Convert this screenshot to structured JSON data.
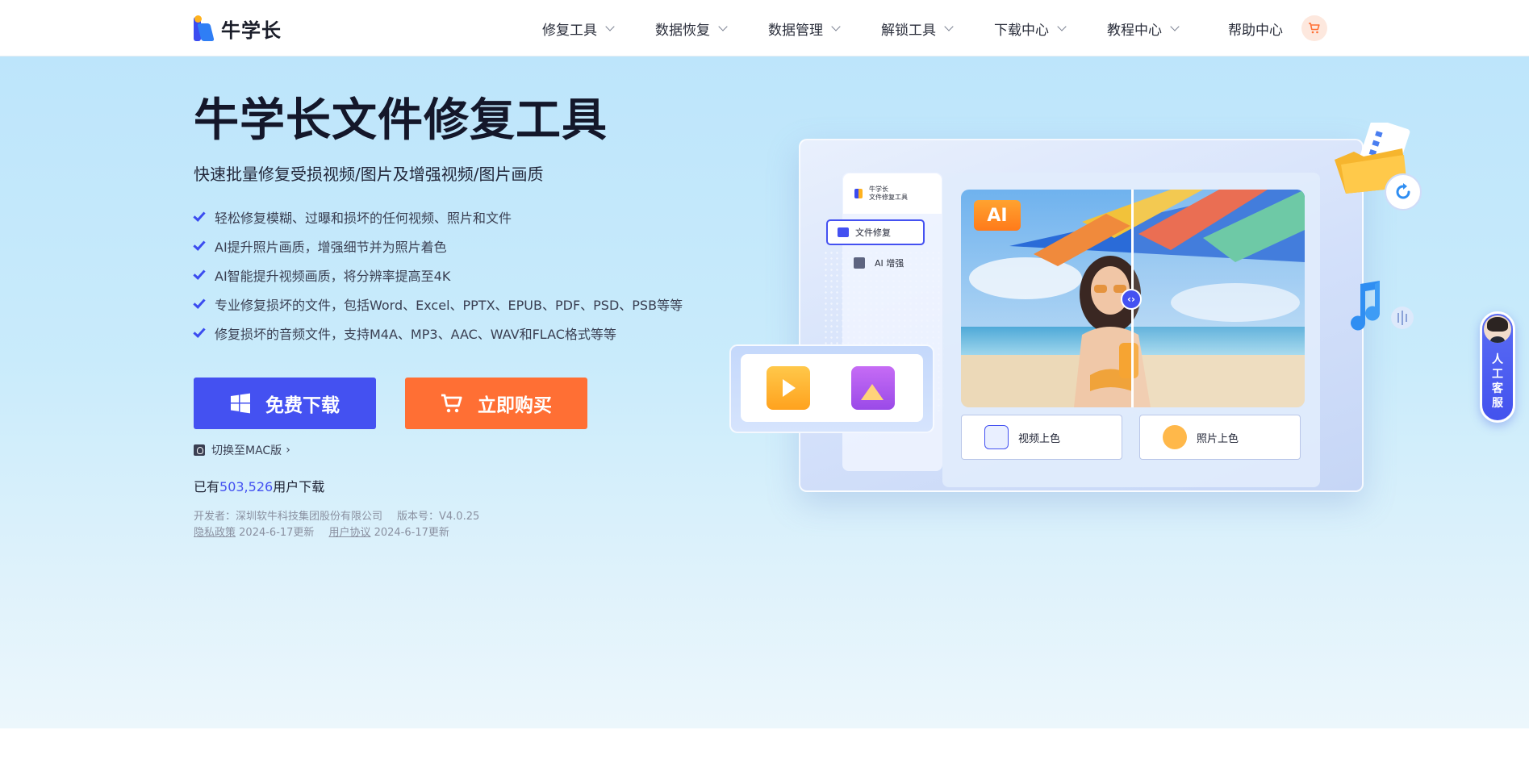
{
  "header": {
    "logo_text": "牛学长",
    "nav": [
      {
        "label": "修复工具"
      },
      {
        "label": "数据恢复"
      },
      {
        "label": "数据管理"
      },
      {
        "label": "解锁工具"
      },
      {
        "label": "下载中心"
      },
      {
        "label": "教程中心"
      }
    ],
    "help_label": "帮助中心",
    "cart_icon": "cart-icon"
  },
  "hero": {
    "title": "牛学长文件修复工具",
    "subtitle": "快速批量修复受损视频/图片及增强视频/图片画质",
    "features": [
      "轻松修复模糊、过曝和损坏的任何视频、照片和文件",
      "AI提升照片画质，增强细节并为照片着色",
      "AI智能提升视频画质，将分辨率提高至4K",
      "专业修复损坏的文件，包括Word、Excel、PPTX、EPUB、PDF、PSD、PSB等等",
      "修复损坏的音频文件，支持M4A、MP3、AAC、WAV和FLAC格式等等"
    ],
    "download_label": "免费下载",
    "buy_label": "立即购买",
    "mac_switch": "切换至MAC版",
    "users_prefix": "已有",
    "users_count": "503,526",
    "users_suffix": "用户下载",
    "developer": "开发者：深圳软牛科技集团股份有限公司",
    "version": "版本号：V4.0.25",
    "privacy_link": "隐私政策",
    "privacy_date": "2024-6-17更新",
    "terms_link": "用户协议",
    "terms_date": "2024-6-17更新"
  },
  "illustration": {
    "app_name_line1": "牛学长",
    "app_name_line2": "文件修复工具",
    "side_file_repair": "文件修复",
    "side_ai_enhance": "AI 增强",
    "ai_badge": "AI",
    "tool_video_color": "视频上色",
    "tool_photo_color": "照片上色"
  },
  "service": {
    "label": "人工客服"
  },
  "colors": {
    "primary": "#4451f1",
    "accent_orange": "#ff6f34",
    "hero_bg": "#c9ebfb"
  }
}
